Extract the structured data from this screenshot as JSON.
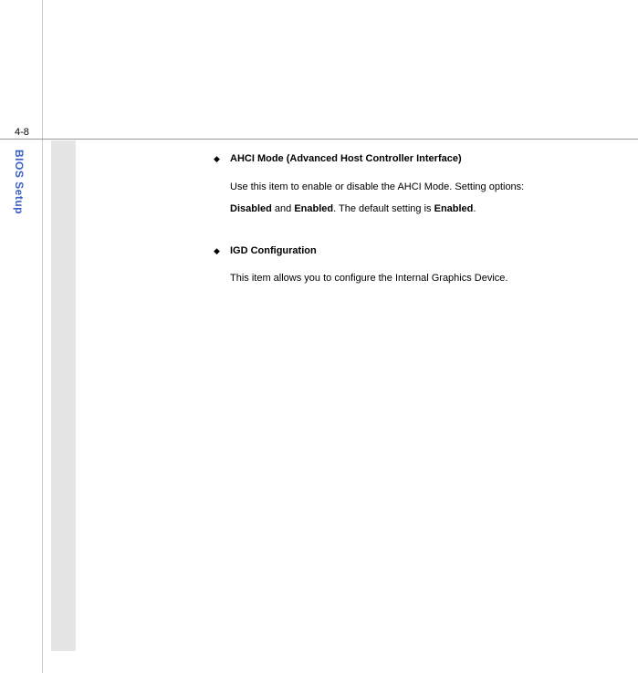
{
  "page": {
    "number": "4-8",
    "side_label": "BIOS Setup"
  },
  "content": {
    "items": [
      {
        "title": "AHCI Mode (Advanced Host Controller Interface)",
        "body_prefix": "Use  this  item  to  enable  or  disable  the  AHCI  Mode.    Setting  options:",
        "opt1": "Disabled",
        "and": " and ",
        "opt2": "Enabled",
        "mid": ".    The default setting is ",
        "opt3": "Enabled",
        "suffix": "."
      },
      {
        "title": "IGD Configuration",
        "body": "This item allows you to configure the Internal Graphics Device."
      }
    ]
  }
}
